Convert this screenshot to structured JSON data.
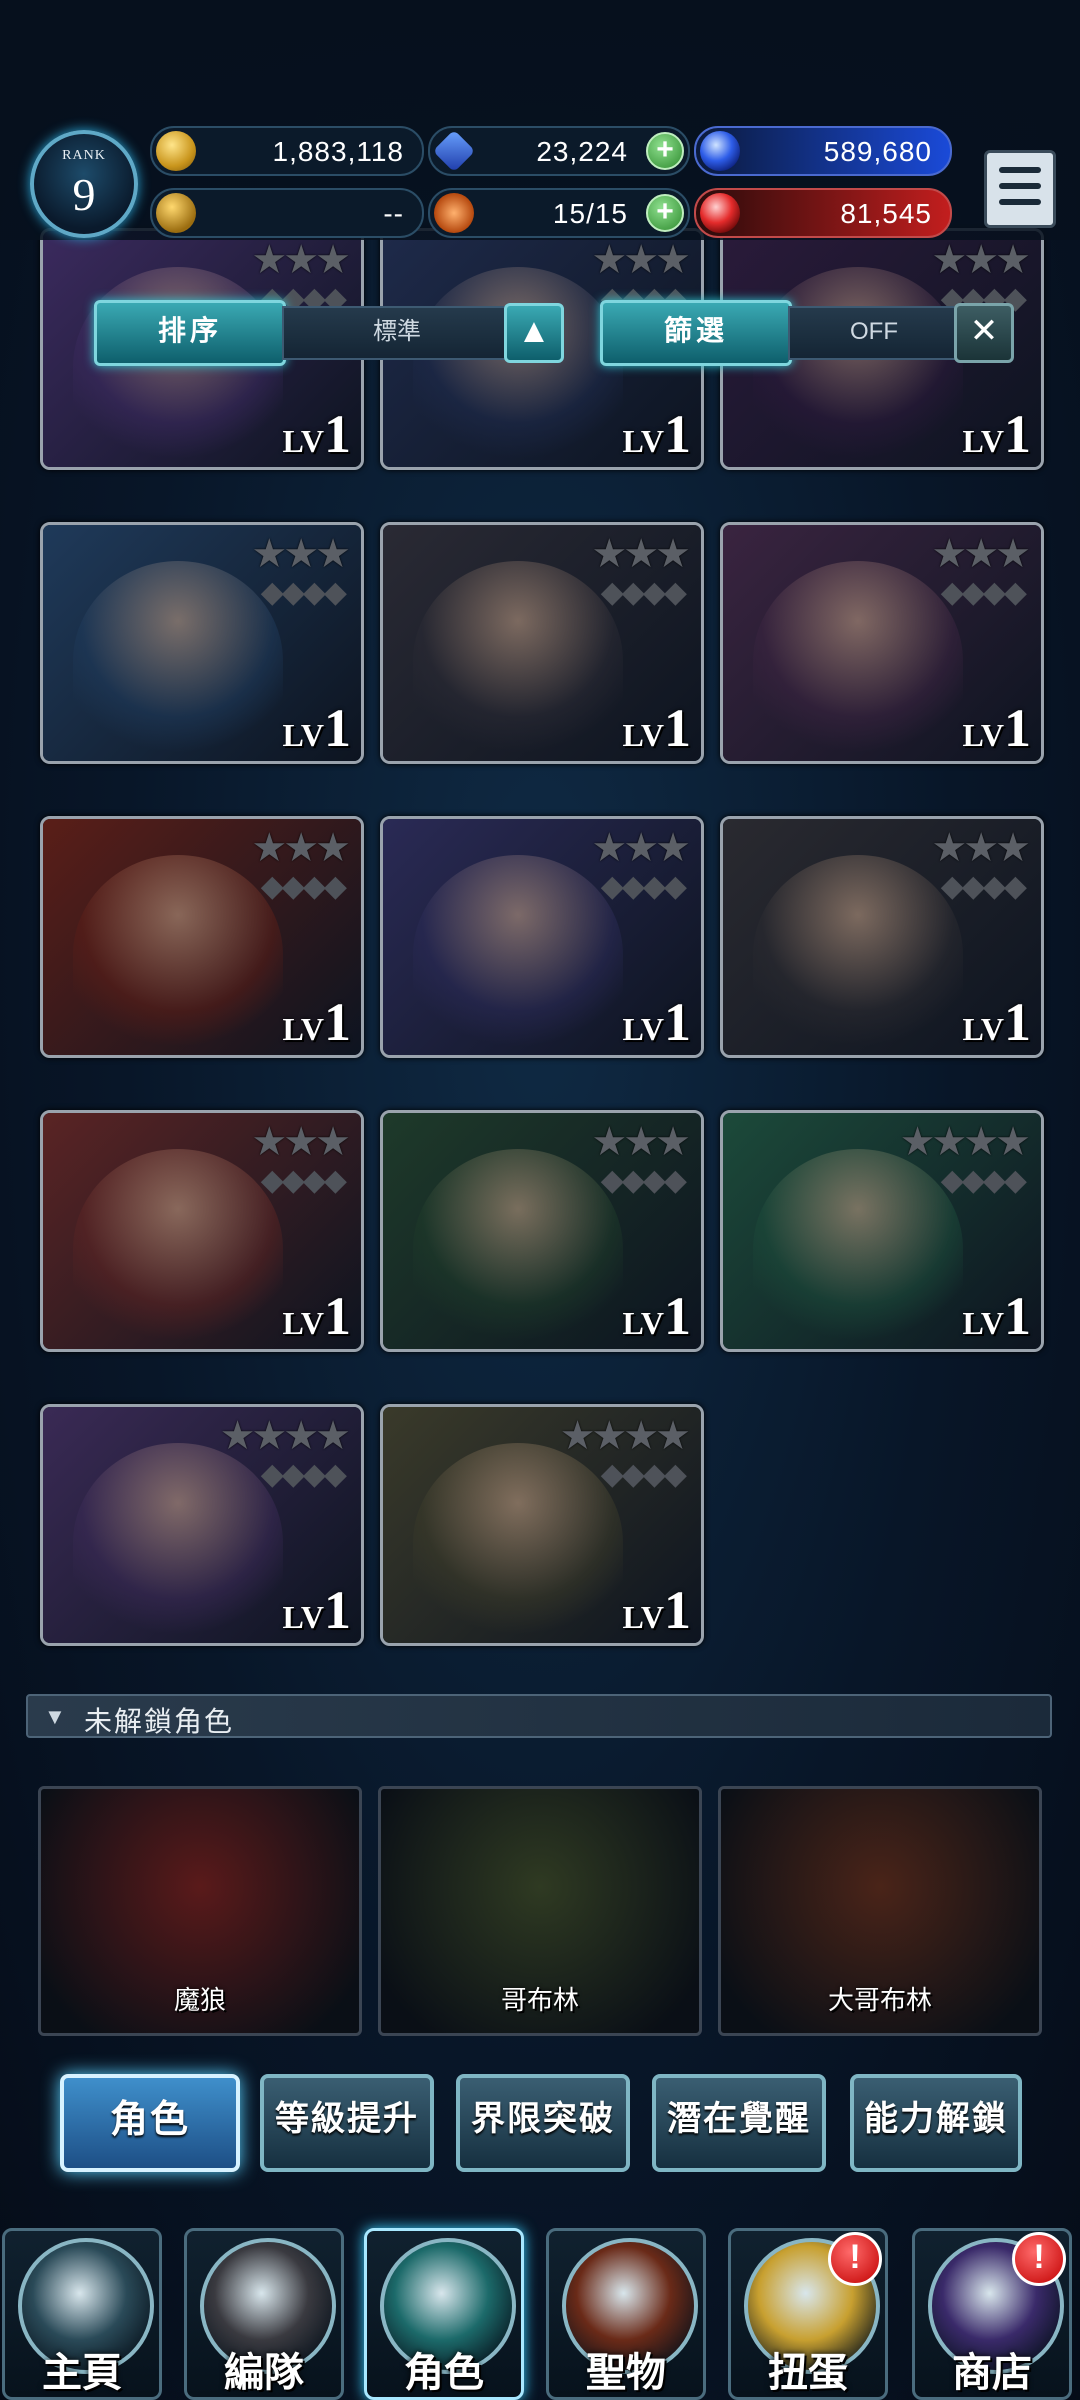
{
  "header": {
    "rank_label": "RANK",
    "rank_value": "9",
    "gold": "1,883,118",
    "gems": "23,224",
    "blue_orbs": "589,680",
    "trophy": "--",
    "stamina": "15/15",
    "red_orbs": "81,545"
  },
  "controls": {
    "sort_label": "排序",
    "sort_value": "標準",
    "filter_label": "篩選",
    "filter_value": "OFF"
  },
  "roster": [
    {
      "level_prefix": "LV",
      "level": "1",
      "stars": "★★★",
      "color": "#3b2a5e"
    },
    {
      "level_prefix": "LV",
      "level": "1",
      "stars": "★★★",
      "color": "#1e2a4a"
    },
    {
      "level_prefix": "LV",
      "level": "1",
      "stars": "★★★",
      "color": "#2a1a3a"
    },
    {
      "level_prefix": "LV",
      "level": "1",
      "stars": "★★★",
      "color": "#1f3a5a"
    },
    {
      "level_prefix": "LV",
      "level": "1",
      "stars": "★★★",
      "color": "#2a2a34"
    },
    {
      "level_prefix": "LV",
      "level": "1",
      "stars": "★★★",
      "color": "#3a2440"
    },
    {
      "level_prefix": "LV",
      "level": "1",
      "stars": "★★★",
      "color": "#5a1e18"
    },
    {
      "level_prefix": "LV",
      "level": "1",
      "stars": "★★★",
      "color": "#2a2a55"
    },
    {
      "level_prefix": "LV",
      "level": "1",
      "stars": "★★★",
      "color": "#2a2a30"
    },
    {
      "level_prefix": "LV",
      "level": "1",
      "stars": "★★★",
      "color": "#5a2424"
    },
    {
      "level_prefix": "LV",
      "level": "1",
      "stars": "★★★",
      "color": "#1e3a2a"
    },
    {
      "level_prefix": "LV",
      "level": "1",
      "stars": "★★★★",
      "color": "#1c4a3a"
    },
    {
      "level_prefix": "LV",
      "level": "1",
      "stars": "★★★★",
      "color": "#3a2a55"
    },
    {
      "level_prefix": "LV",
      "level": "1",
      "stars": "★★★★",
      "color": "#3a3a2a"
    }
  ],
  "locked_section": {
    "title": "未解鎖角色",
    "items": [
      {
        "name": "魔狼",
        "color": "#5a1a1a"
      },
      {
        "name": "哥布林",
        "color": "#2f3a22"
      },
      {
        "name": "大哥布林",
        "color": "#4a2418"
      }
    ]
  },
  "tabs": [
    {
      "label": "角色"
    },
    {
      "label": "等級提升"
    },
    {
      "label": "界限突破"
    },
    {
      "label": "潛在覺醒"
    },
    {
      "label": "能力解鎖"
    }
  ],
  "nav": [
    {
      "label": "主頁",
      "icon": "home-icon",
      "color": "#2a4a58"
    },
    {
      "label": "編隊",
      "icon": "party-icon",
      "color": "#3a3a40"
    },
    {
      "label": "角色",
      "icon": "character-icon",
      "color": "#1c6a6a"
    },
    {
      "label": "聖物",
      "icon": "relic-icon",
      "color": "#6a2a18"
    },
    {
      "label": "扭蛋",
      "icon": "gacha-icon",
      "color": "#c8a030",
      "alert": "!"
    },
    {
      "label": "商店",
      "icon": "shop-icon",
      "color": "#3a2a6a",
      "alert": "!"
    }
  ]
}
